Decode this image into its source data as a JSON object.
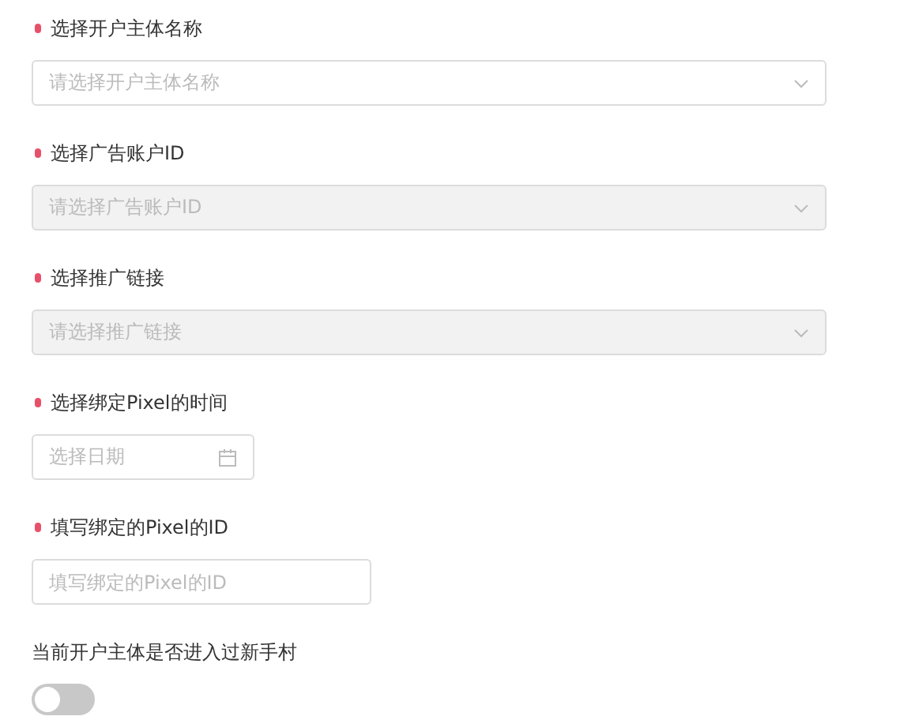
{
  "fields": [
    {
      "kind": "select",
      "label": "选择开户主体名称",
      "required": true,
      "placeholder": "请选择开户主体名称",
      "disabled": false
    },
    {
      "kind": "select",
      "label": "选择广告账户ID",
      "required": true,
      "placeholder": "请选择广告账户ID",
      "disabled": true
    },
    {
      "kind": "select",
      "label": "选择推广链接",
      "required": true,
      "placeholder": "请选择推广链接",
      "disabled": true
    },
    {
      "kind": "date",
      "label": "选择绑定Pixel的时间",
      "required": true,
      "placeholder": "选择日期",
      "disabled": false
    },
    {
      "kind": "input",
      "label": "填写绑定的Pixel的ID",
      "required": true,
      "placeholder": "填写绑定的Pixel的ID",
      "disabled": false
    }
  ],
  "toggle": {
    "label": "当前开户主体是否进入过新手村",
    "on": false
  }
}
